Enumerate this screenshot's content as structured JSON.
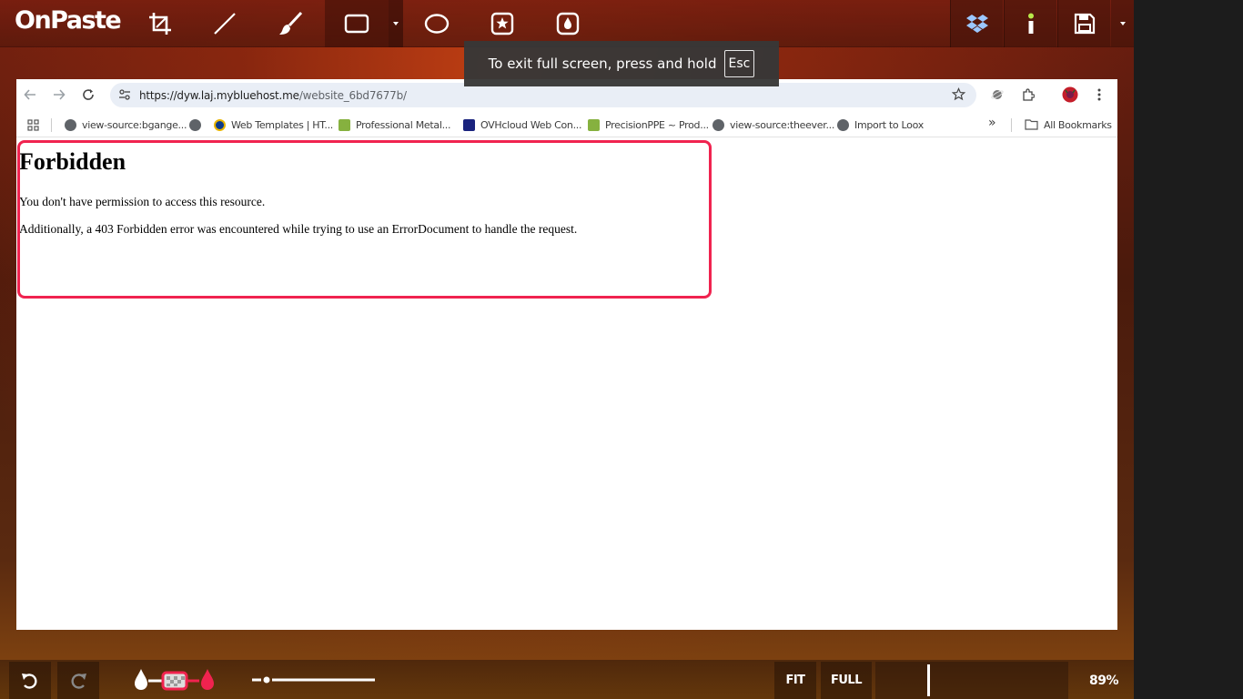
{
  "app": {
    "name": "OnPaste",
    "zoom": "89%",
    "fit_label": "FIT",
    "full_label": "FULL"
  },
  "toolbar": {
    "tools": [
      {
        "name": "crop-icon"
      },
      {
        "name": "line-icon"
      },
      {
        "name": "brush-icon"
      },
      {
        "name": "rectangle-icon",
        "active": true
      },
      {
        "name": "ellipse-icon"
      },
      {
        "name": "star-stamp-icon"
      },
      {
        "name": "blur-drop-icon"
      }
    ],
    "right_tools": [
      "dropbox-icon",
      "info-icon",
      "save-icon"
    ]
  },
  "fullscreen_toast": {
    "message": "To exit full screen, press and hold",
    "key": "Esc"
  },
  "browser": {
    "url_host": "https://dyw.laj.mybluehost.me",
    "url_path": "/website_6bd7677b/",
    "bookmarks": [
      {
        "label": "view-source:bgange..."
      },
      {
        "label": ""
      },
      {
        "label": "Web Templates | HT..."
      },
      {
        "label": "Professional Metal..."
      },
      {
        "label": "OVHcloud Web Con..."
      },
      {
        "label": "PrecisionPPE ~ Prod..."
      },
      {
        "label": "view-source:theever..."
      },
      {
        "label": "Import to Loox"
      }
    ],
    "all_bookmarks": "All Bookmarks",
    "overflow": "»"
  },
  "page": {
    "heading": "Forbidden",
    "line1": "You don't have permission to access this resource.",
    "line2": "Additionally, a 403 Forbidden error was encountered while trying to use an ErrorDocument to handle the request."
  },
  "colors": {
    "highlight": "#f0234f",
    "accent": "#f0234f"
  }
}
